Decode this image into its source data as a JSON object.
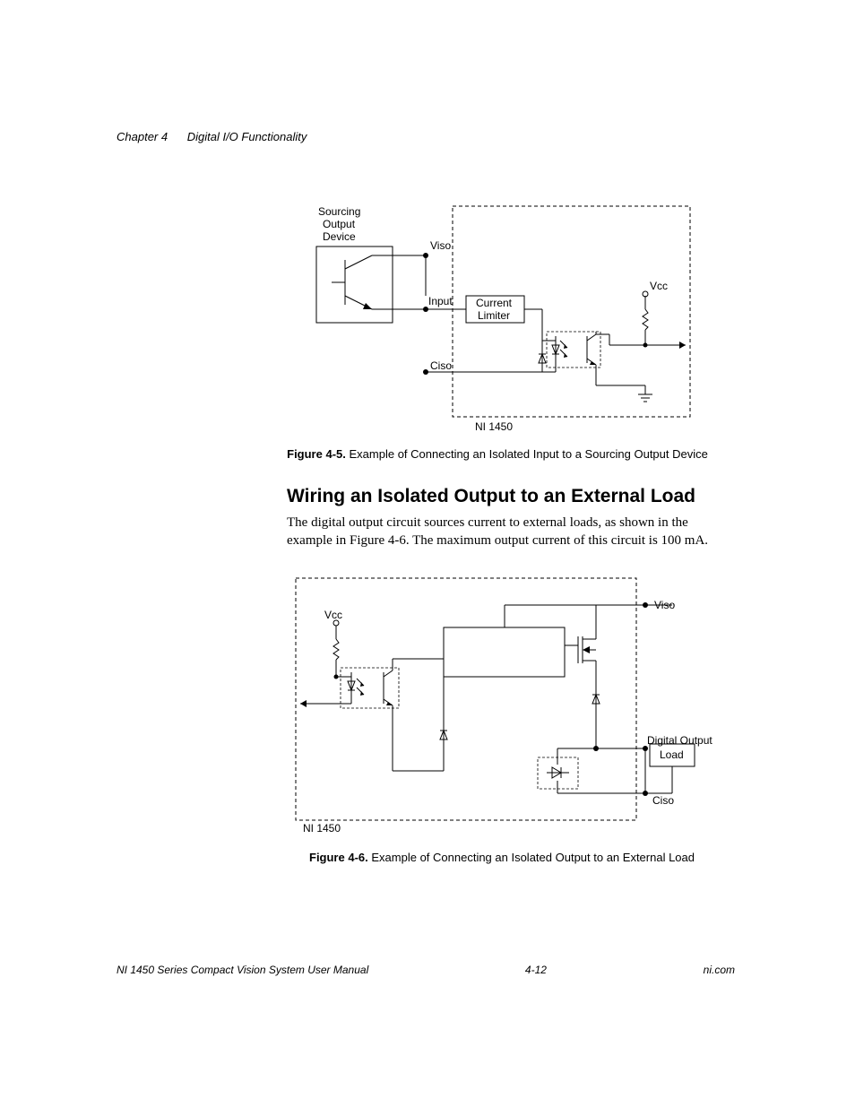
{
  "header": {
    "chapter": "Chapter 4",
    "title": "Digital I/O Functionality"
  },
  "figure1": {
    "labels": {
      "sourcing1": "Sourcing",
      "sourcing2": "Output",
      "sourcing3": "Device",
      "viso": "Viso",
      "input": "Input",
      "current1": "Current",
      "current2": "Limiter",
      "vcc": "Vcc",
      "ciso": "Ciso",
      "ni": "NI 1450"
    },
    "caption_num": "Figure 4-5.",
    "caption_text": "Example of Connecting an Isolated Input to a Sourcing Output Device"
  },
  "section_heading": "Wiring an Isolated Output to an External Load",
  "body_text": "The digital output circuit sources current to external loads, as shown in the example in Figure 4-6. The maximum output current of this circuit is 100 mA.",
  "figure2": {
    "labels": {
      "vcc": "Vcc",
      "viso": "Viso",
      "digital_output": "Digital Output",
      "load": "Load",
      "ciso": "Ciso",
      "ni": "NI 1450"
    },
    "caption_num": "Figure 4-6.",
    "caption_text": "Example of Connecting an Isolated Output to an External Load"
  },
  "footer": {
    "left": "NI 1450 Series Compact Vision System User Manual",
    "center": "4-12",
    "right": "ni.com"
  }
}
